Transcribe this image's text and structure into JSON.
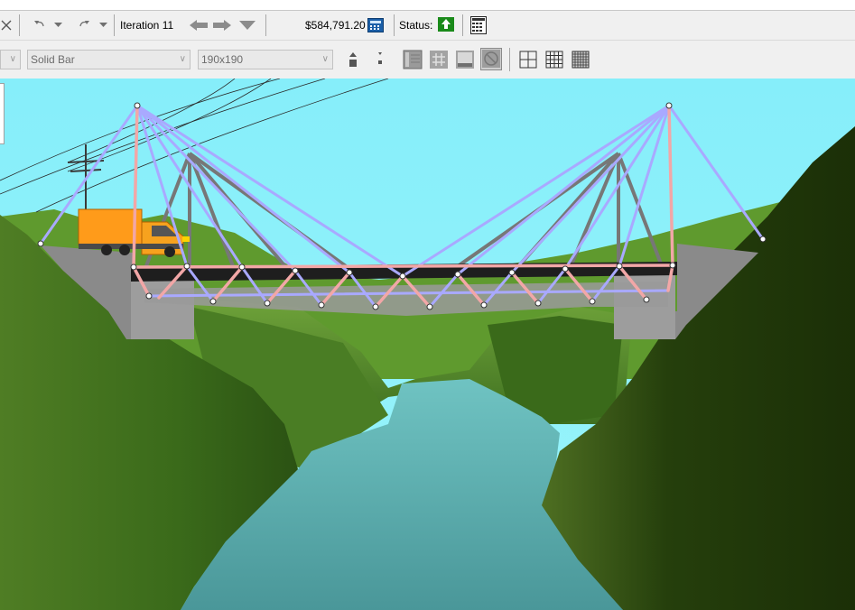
{
  "toolbar": {
    "iteration_label": "Iteration 11",
    "cost_value": "$584,791.20",
    "status_label": "Status:",
    "material_value": "Solid Bar",
    "size_value": "190x190"
  },
  "status": {
    "state": "pass",
    "color": "#1a8a1a"
  },
  "icons": [
    "close-icon",
    "undo-icon",
    "redo-icon",
    "back-arrow-icon",
    "forward-arrow-icon",
    "iteration-dropdown-icon",
    "calculator-icon",
    "status-pass-icon",
    "load-test-report-icon",
    "increase-size-icon",
    "decrease-size-icon",
    "member-list-icon",
    "grid-icon",
    "member-table-icon",
    "no-labels-icon",
    "coarse-grid-icon",
    "medium-grid-icon",
    "fine-grid-icon"
  ],
  "colors": {
    "sky": "#8ff0fb",
    "river": "#4f9fa2",
    "hills": "#3f6e1f",
    "tension_member": "#f2a7a7",
    "compression_member": "#a9a9ff",
    "truck": "#ff9b1a"
  }
}
